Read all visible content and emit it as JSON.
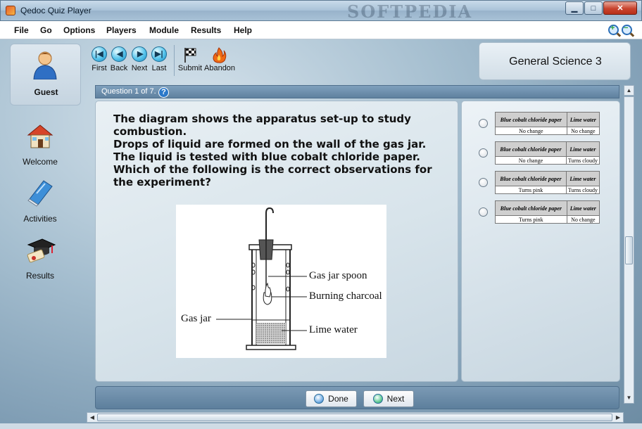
{
  "window": {
    "title": "Qedoc Quiz Player",
    "watermark": "SOFTPEDIA",
    "controls": {
      "minimize": "▁",
      "maximize": "□",
      "close": "✕"
    }
  },
  "menu": [
    "File",
    "Go",
    "Options",
    "Players",
    "Module",
    "Results",
    "Help"
  ],
  "user": {
    "name": "Guest",
    "icon": "user-avatar"
  },
  "nav": [
    {
      "label": "Welcome",
      "icon": "house-icon"
    },
    {
      "label": "Activities",
      "icon": "book-icon"
    },
    {
      "label": "Results",
      "icon": "graduation-cap-icon"
    }
  ],
  "toolbar": {
    "first": "First",
    "back": "Back",
    "next": "Next",
    "last": "Last",
    "submit": "Submit",
    "abandon": "Abandon"
  },
  "subject": "General Science 3",
  "question": {
    "counter": "Question 1 of 7.",
    "help": "?",
    "text_1": "The diagram shows the apparatus set-up to study combustion.",
    "text_2": "Drops of liquid are formed on the wall of the gas jar. The liquid is tested with blue cobalt chloride paper. Which of the following is the correct observations for the experiment?",
    "figure_labels": {
      "spoon": "Gas jar spoon",
      "charcoal": "Burning charcoal",
      "jar": "Gas jar",
      "water": "Lime water"
    }
  },
  "answers": {
    "col_a": "Blue cobalt chloride paper",
    "col_b": "Lime water",
    "options": [
      {
        "a": "No change",
        "b": "No change"
      },
      {
        "a": "No change",
        "b": "Turns cloudy"
      },
      {
        "a": "Turns pink",
        "b": "Turns cloudy"
      },
      {
        "a": "Turns pink",
        "b": "No change"
      }
    ]
  },
  "buttons": {
    "done": "Done",
    "next": "Next"
  },
  "colors": {
    "accent": "#5f819f",
    "panel": "#e9f0f4",
    "title_bar": "#a9c2d8"
  }
}
